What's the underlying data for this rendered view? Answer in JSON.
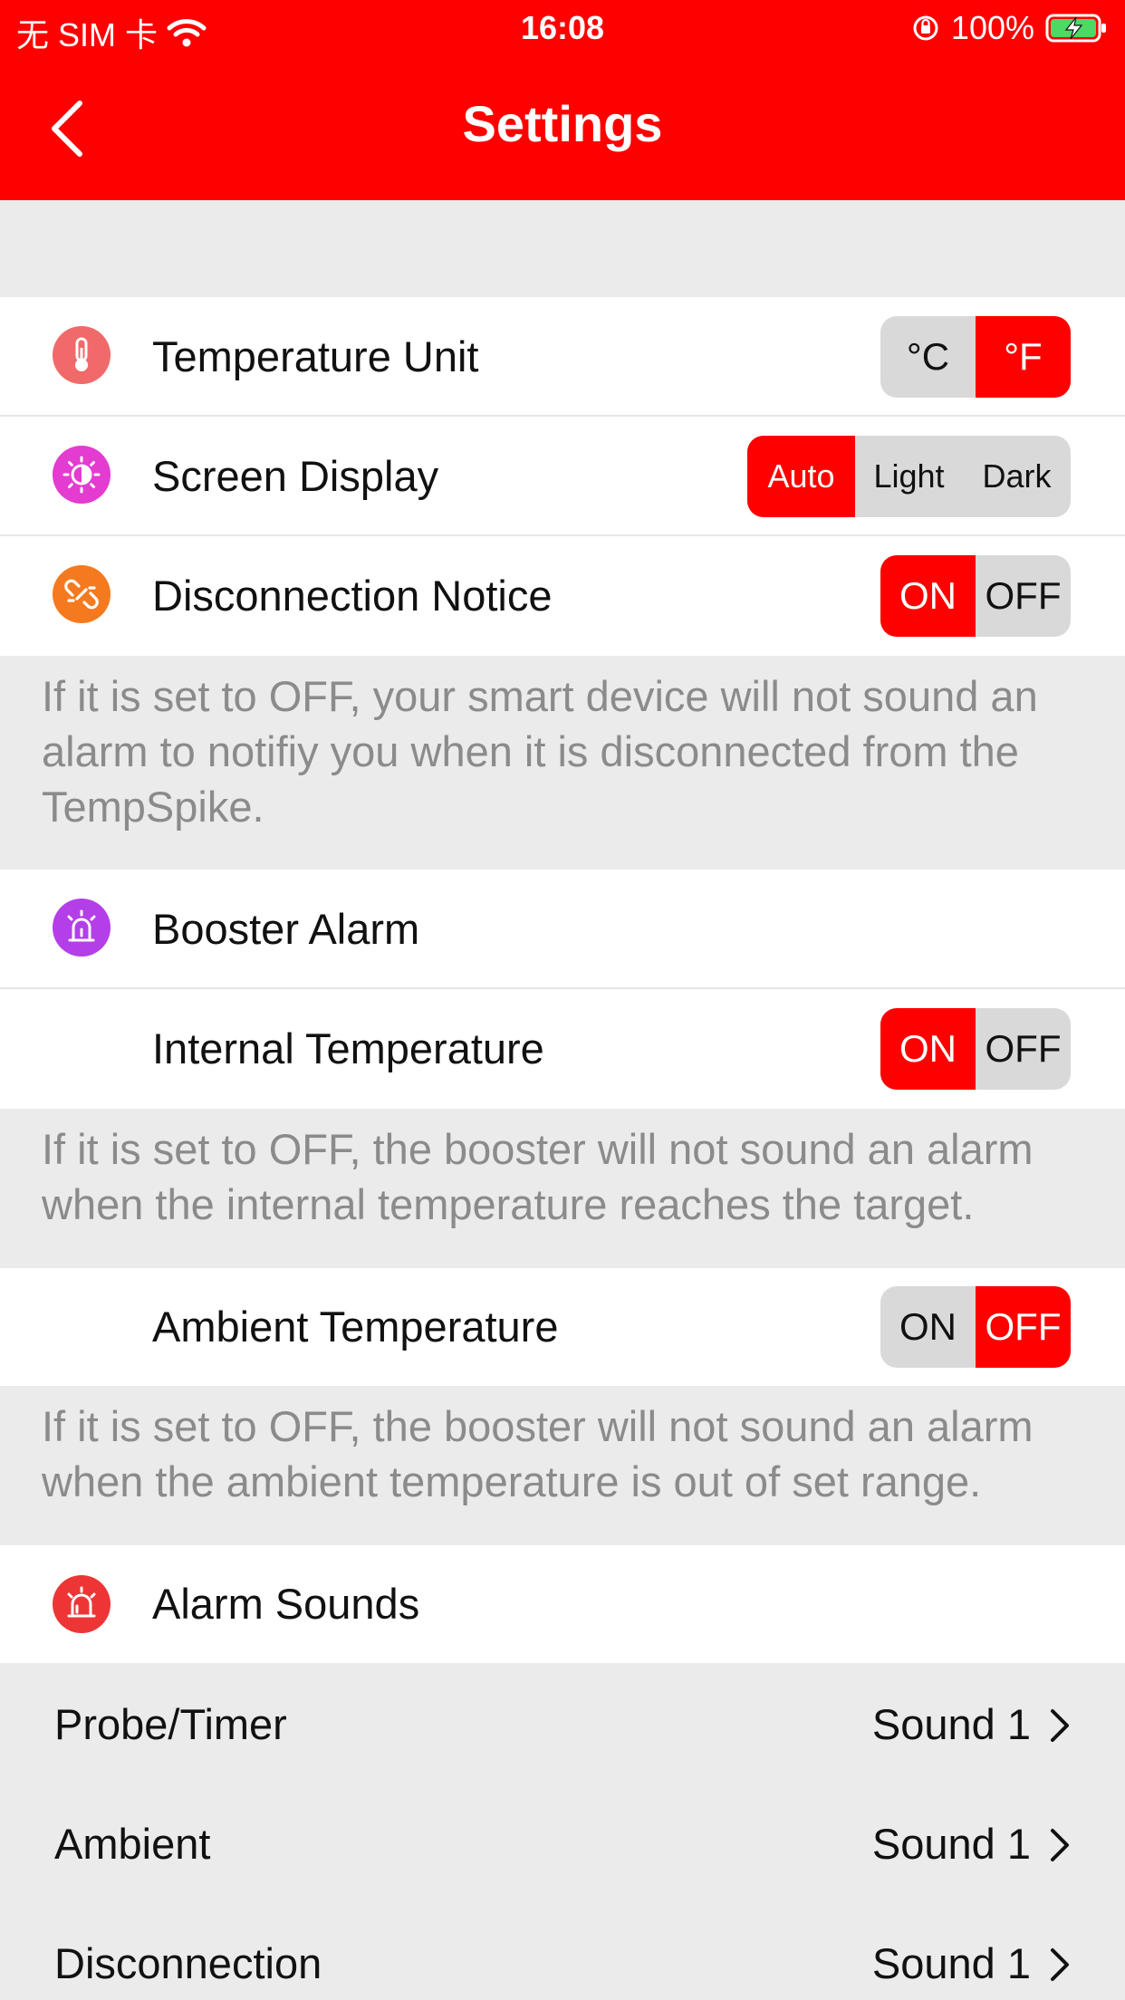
{
  "status_bar": {
    "carrier": "无 SIM 卡",
    "time": "16:08",
    "battery": "100%"
  },
  "header": {
    "title": "Settings"
  },
  "settings": {
    "temperature_unit": {
      "label": "Temperature Unit",
      "options": [
        "°C",
        "°F"
      ],
      "selected": "°F"
    },
    "screen_display": {
      "label": "Screen Display",
      "options": [
        "Auto",
        "Light",
        "Dark"
      ],
      "selected": "Auto"
    },
    "disconnection_notice": {
      "label": "Disconnection Notice",
      "on": "ON",
      "off": "OFF",
      "selected": "ON",
      "note": "If it is set to OFF, your smart device will not sound an alarm to notifiy you when it is disconnected from the TempSpike."
    },
    "booster_alarm": {
      "label": "Booster Alarm"
    },
    "internal_temperature": {
      "label": "Internal Temperature",
      "on": "ON",
      "off": "OFF",
      "selected": "ON",
      "note": "If it is set to OFF, the booster will not sound an alarm when the internal temperature reaches the target."
    },
    "ambient_temperature": {
      "label": "Ambient Temperature",
      "on": "ON",
      "off": "OFF",
      "selected": "OFF",
      "note": "If it is set to OFF, the booster will not sound an alarm when the ambient temperature is out of set range."
    },
    "alarm_sounds": {
      "label": "Alarm Sounds",
      "items": [
        {
          "label": "Probe/Timer",
          "value": "Sound 1"
        },
        {
          "label": "Ambient",
          "value": "Sound 1"
        },
        {
          "label": "Disconnection",
          "value": "Sound 1"
        }
      ]
    }
  },
  "icons": {
    "temperature_unit": "thermometer-icon",
    "screen_display": "brightness-icon",
    "disconnection_notice": "unlink-icon",
    "booster_alarm": "siren-icon",
    "alarm_sounds": "alarm-bell-icon"
  },
  "colors": {
    "accent": "#fe0000",
    "icon_thermometer": "#f06a6a",
    "icon_brightness": "#e43bd0",
    "icon_unlink": "#f57a1f",
    "icon_siren": "#b43fe8",
    "icon_alarm": "#ee3535"
  }
}
